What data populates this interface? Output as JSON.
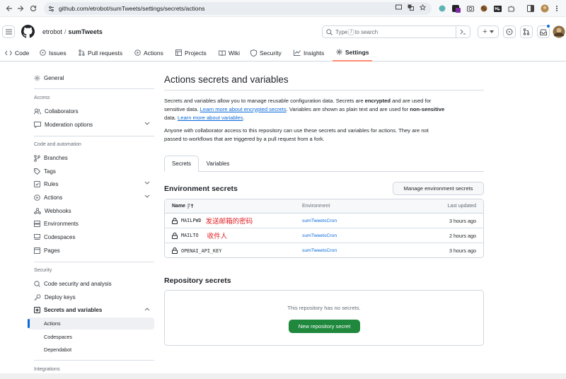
{
  "browser": {
    "url": "github.com/etrobot/sumTweets/settings/secrets/actions"
  },
  "header": {
    "owner": "etrobot",
    "separator": "/",
    "repo": "sumTweets",
    "search_prefix": "Type",
    "search_key": "/",
    "search_suffix": "to search",
    "plus_label": "+"
  },
  "tabs": [
    {
      "label": "Code",
      "icon": "code-icon"
    },
    {
      "label": "Issues",
      "icon": "issue-icon"
    },
    {
      "label": "Pull requests",
      "icon": "pull-request-icon"
    },
    {
      "label": "Actions",
      "icon": "play-icon"
    },
    {
      "label": "Projects",
      "icon": "table-icon"
    },
    {
      "label": "Wiki",
      "icon": "book-icon"
    },
    {
      "label": "Security",
      "icon": "shield-icon"
    },
    {
      "label": "Insights",
      "icon": "graph-icon"
    },
    {
      "label": "Settings",
      "icon": "gear-icon"
    }
  ],
  "sidebar": {
    "general": "General",
    "access_heading": "Access",
    "collaborators": "Collaborators",
    "moderation": "Moderation options",
    "code_heading": "Code and automation",
    "branches": "Branches",
    "tags": "Tags",
    "rules": "Rules",
    "actions": "Actions",
    "webhooks": "Webhooks",
    "environments": "Environments",
    "codespaces": "Codespaces",
    "pages": "Pages",
    "security_heading": "Security",
    "code_security": "Code security and analysis",
    "deploy_keys": "Deploy keys",
    "secrets_vars": "Secrets and variables",
    "sub_actions": "Actions",
    "sub_codespaces": "Codespaces",
    "sub_dependabot": "Dependabot",
    "integrations_heading": "Integrations"
  },
  "main": {
    "title": "Actions secrets and variables",
    "intro_1": "Secrets and variables allow you to manage reusable configuration data. Secrets are ",
    "intro_encrypted": "encrypted",
    "intro_2": " and are used for",
    "intro_3": "sensitive data. ",
    "intro_link1": "Learn more about encrypted secrets",
    "intro_4": ". Variables are shown as plain text and are used for ",
    "intro_nonsensitive": "non-sensitive",
    "intro_5": "data. ",
    "intro_link2": "Learn more about variables",
    "intro_6": ".",
    "access_note_1": "Anyone with collaborator access to this repository can use these secrets and variables for actions. They are not",
    "access_note_2": "passed to workflows that are triggered by a pull request from a fork.",
    "subtab_secrets": "Secrets",
    "subtab_variables": "Variables",
    "env_secrets_title": "Environment secrets",
    "manage_env_button": "Manage environment secrets",
    "col_name": "Name",
    "col_environment": "Environment",
    "col_updated": "Last updated",
    "env_secrets": [
      {
        "name": "MAILPWD",
        "environment": "sumTweetsCron",
        "updated": "3 hours ago",
        "note": "发送邮箱的密码"
      },
      {
        "name": "MAILTO",
        "environment": "sumTweetsCron",
        "updated": "2 hours ago",
        "note": "收件人"
      },
      {
        "name": "OPENAI_API_KEY",
        "environment": "sumTweetsCron",
        "updated": "3 hours ago",
        "note": ""
      }
    ],
    "repo_secrets_title": "Repository secrets",
    "no_secrets": "This repository has no secrets.",
    "new_secret_button": "New repository secret"
  },
  "colors": {
    "accent": "#0969da",
    "primary_button": "#1f883d",
    "tab_underline": "#fd8c73",
    "annotation": "#e11d21"
  }
}
